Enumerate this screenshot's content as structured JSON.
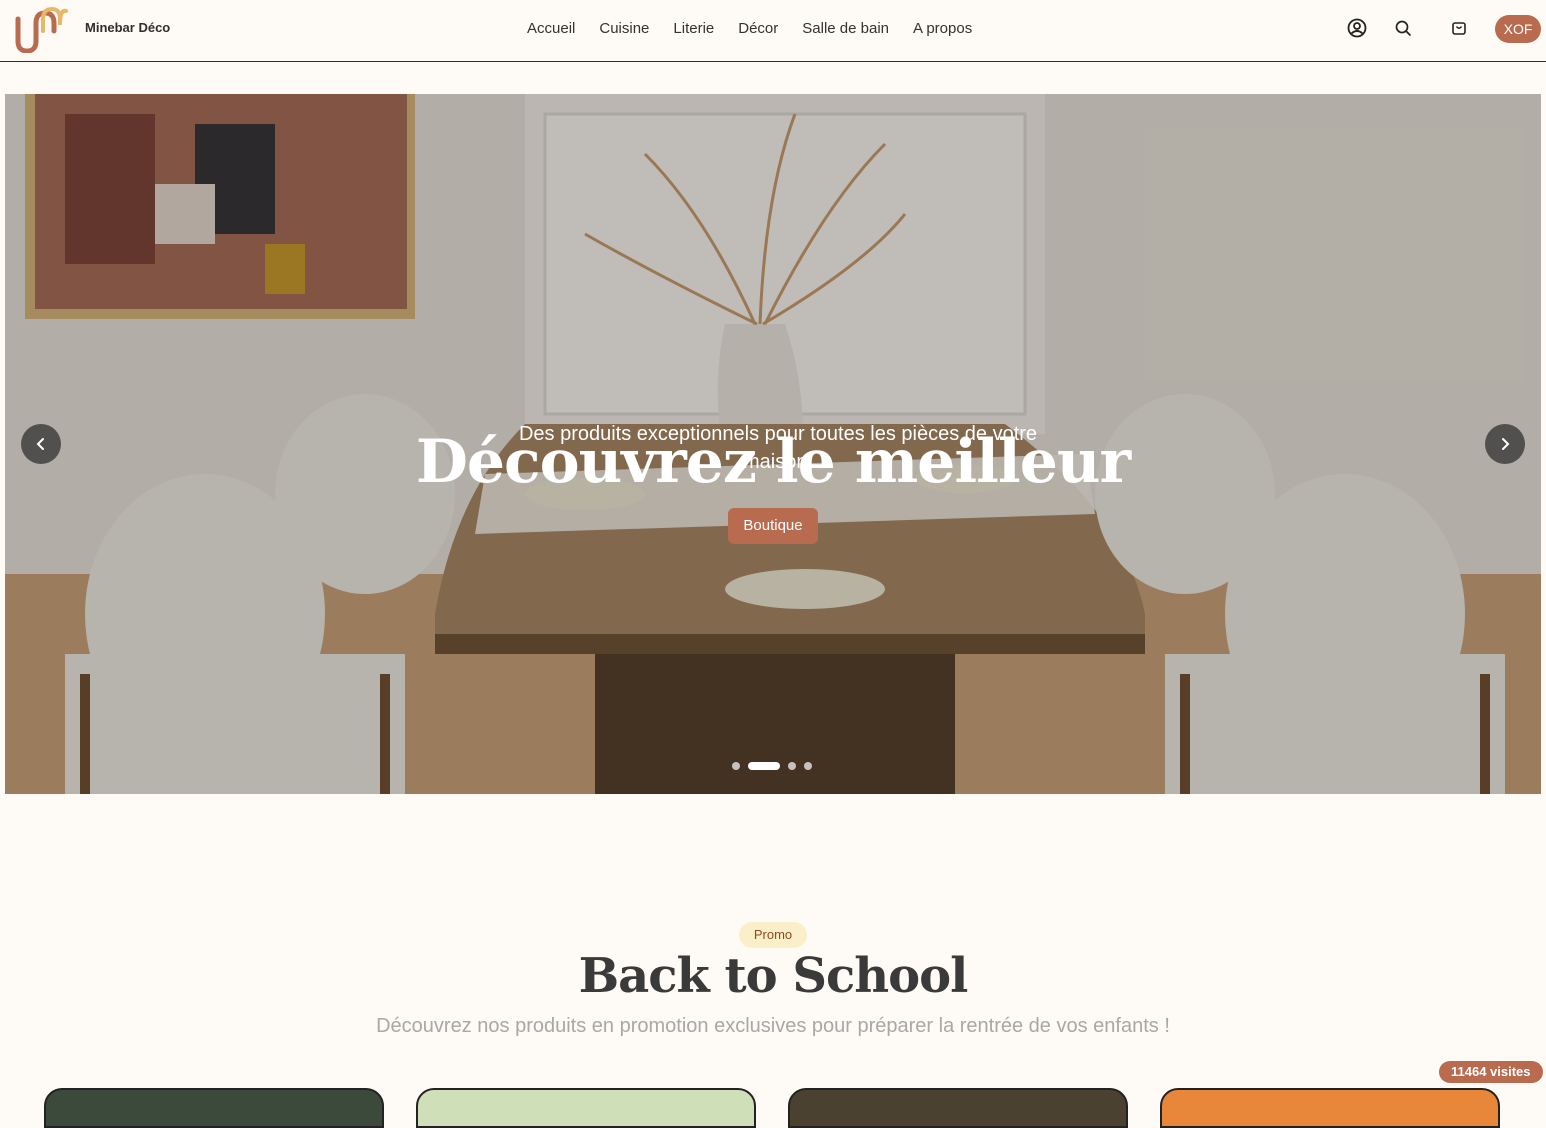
{
  "header": {
    "brand": "Minebar Déco",
    "nav": [
      "Accueil",
      "Cuisine",
      "Literie",
      "Décor",
      "Salle de bain",
      "A propos"
    ],
    "icons": [
      "user-icon",
      "search-icon",
      "cart-icon"
    ],
    "currency": "XOF"
  },
  "hero": {
    "title": "Découvrez le meilleur",
    "subtitle": "Des produits exceptionnels pour toutes les pièces de votre maison.",
    "button": "Boutique",
    "slides_count": 4,
    "active_slide": 2
  },
  "promo": {
    "badge": "Promo",
    "title": "Back to School",
    "subtitle": "Découvrez nos produits en promotion exclusives pour préparer la rentrée de vos enfants !"
  },
  "visits": "11464 visites",
  "colors": {
    "accent": "#b96b4f",
    "background": "#fefaf5",
    "badge_bg": "#fbefc9"
  }
}
